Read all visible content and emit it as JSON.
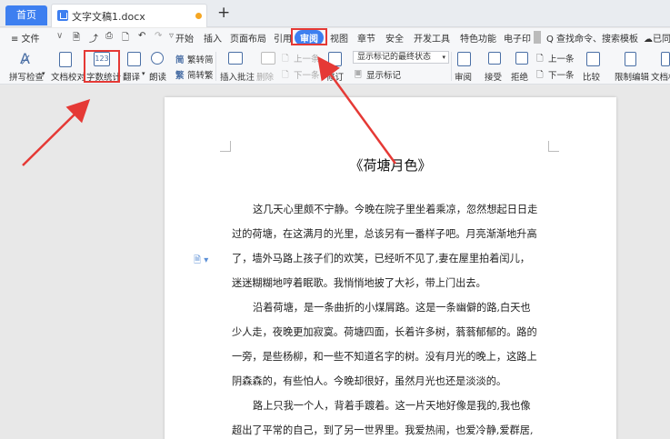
{
  "tabs": {
    "home": "首页",
    "document": "文字文稿1.docx",
    "close": "×",
    "add": "+"
  },
  "menu": {
    "file": "≡ 文件",
    "items": [
      "开始",
      "插入",
      "页面布局",
      "引用",
      "审阅",
      "视图",
      "章节",
      "安全",
      "开发工具",
      "特色功能",
      "电子印"
    ],
    "active": "审阅",
    "search": "Q 查找命令、搜索模板",
    "share": "已同"
  },
  "ribbon": {
    "spellcheck": "拼写检查",
    "doc_check": "文档校对",
    "word_count": "字数统计",
    "word_count_icon_text": "123",
    "translate": "翻译",
    "read_aloud": "朗读",
    "trad_convert": "繁转简",
    "simp_convert": "简转繁",
    "insert_comment": "插入批注",
    "delete_comment": "删除",
    "prev_comment": "上一条",
    "next_comment": "下一条",
    "track_changes": "修订",
    "markup_mode": "显示标记的最终状态",
    "show_markup": "显示标记",
    "review_pane": "审阅",
    "accept": "接受",
    "reject": "拒绝",
    "prev_change": "上一条",
    "next_change": "下一条",
    "compare": "比较",
    "restrict_edit": "限制编辑",
    "doc_rights": "文档权"
  },
  "document": {
    "title": "《荷塘月色》",
    "lines": [
      "这几天心里颇不宁静。今晚在院子里坐着乘凉，忽然想起日日走",
      "过的荷塘，在这满月的光里，总该另有一番样子吧。月亮渐渐地升高",
      "了，墙外马路上孩子们的欢笑，已经听不见了,妻在屋里拍着闰儿，",
      "迷迷糊糊地哼着眠歌。我悄悄地披了大衫，带上门出去。",
      "沿着荷塘，是一条曲折的小煤屑路。这是一条幽僻的路,白天也",
      "少人走，夜晚更加寂寞。荷塘四面，长着许多树，蓊蓊郁郁的。路的",
      "一旁，是些杨柳，和一些不知道名字的树。没有月光的晚上，这路上",
      "阴森森的，有些怕人。今晚却很好，虽然月光也还是淡淡的。",
      "路上只我一个人，背着手踱着。这一片天地好像是我的,我也像",
      "超出了平常的自己，到了另一世界里。我爱热闹，也爱冷静,爱群居,"
    ]
  },
  "colors": {
    "accent": "#3d7ff0",
    "highlight_box": "#e53935",
    "unsaved": "#f5a623"
  }
}
